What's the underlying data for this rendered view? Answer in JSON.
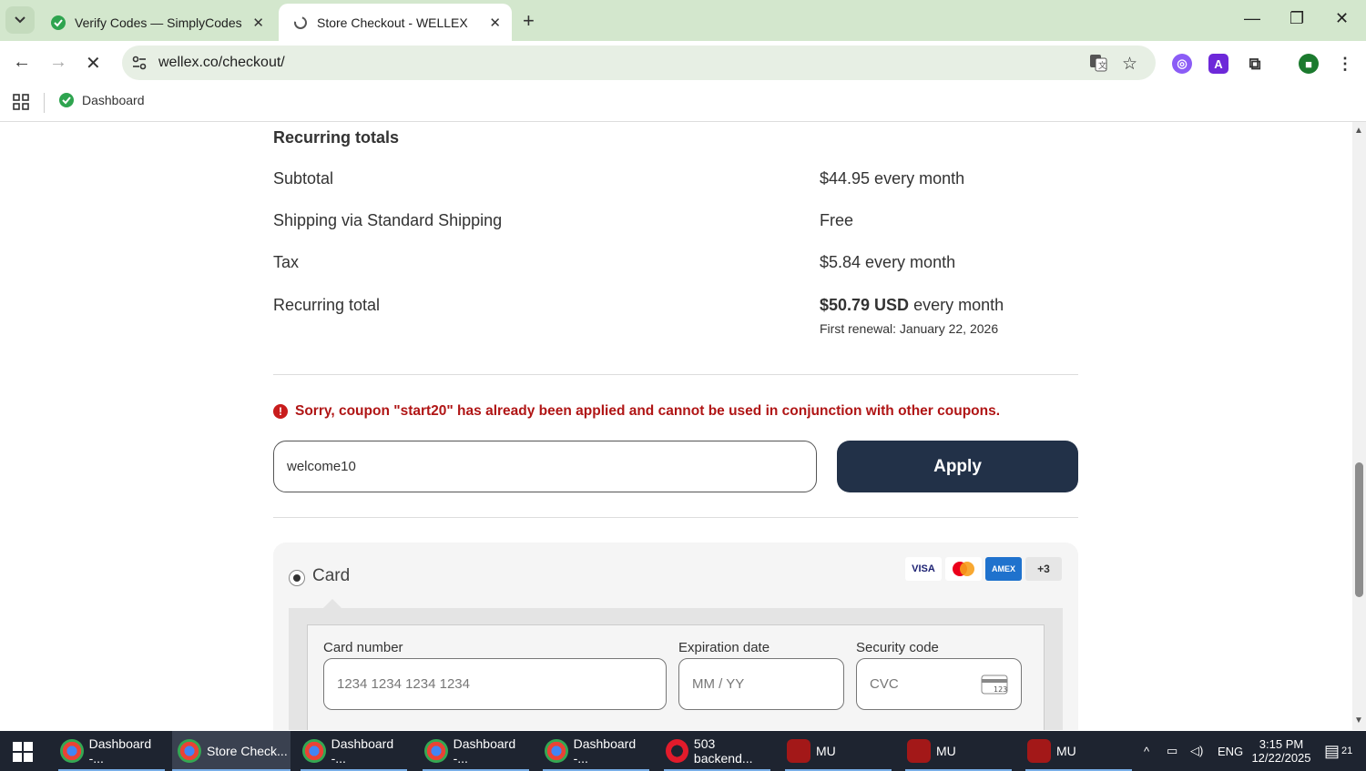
{
  "browser": {
    "tabs": [
      {
        "title": "Verify Codes — SimplyCodes",
        "active": false
      },
      {
        "title": "Store Checkout - WELLEX",
        "active": true
      }
    ],
    "url": "wellex.co/checkout/",
    "bookmark": "Dashboard"
  },
  "recurring": {
    "title": "Recurring totals",
    "rows": [
      {
        "label": "Subtotal",
        "value": "$44.95 every month"
      },
      {
        "label": "Shipping via Standard Shipping",
        "value": "Free"
      },
      {
        "label": "Tax",
        "value": "$5.84 every month"
      }
    ],
    "total_label": "Recurring total",
    "total_amount": "$50.79 USD",
    "total_suffix": " every month",
    "renewal": "First renewal: January 22, 2026"
  },
  "coupon": {
    "error": "Sorry, coupon \"start20\" has already been applied and cannot be used in conjunction with other coupons.",
    "value": "welcome10",
    "apply_label": "Apply"
  },
  "payment": {
    "method_label": "Card",
    "brands": [
      "VISA",
      "",
      "AMEX",
      "+3"
    ],
    "card_number_label": "Card number",
    "card_number_placeholder": "1234 1234 1234 1234",
    "expiry_label": "Expiration date",
    "expiry_placeholder": "MM / YY",
    "cvc_label": "Security code",
    "cvc_placeholder": "CVC",
    "cvc_icon_text": "123"
  },
  "taskbar": {
    "items": [
      "Dashboard -...",
      "Store Check...",
      "Dashboard -...",
      "Dashboard -...",
      "Dashboard -...",
      "503 backend...",
      "MU",
      "MU",
      "MU"
    ],
    "lang": "ENG",
    "time": "3:15 PM",
    "date": "12/22/2025",
    "notif_count": "21"
  },
  "colors": {
    "accent": "#223148",
    "error": "#b01515",
    "chrome_frame": "#d3e7cd"
  }
}
